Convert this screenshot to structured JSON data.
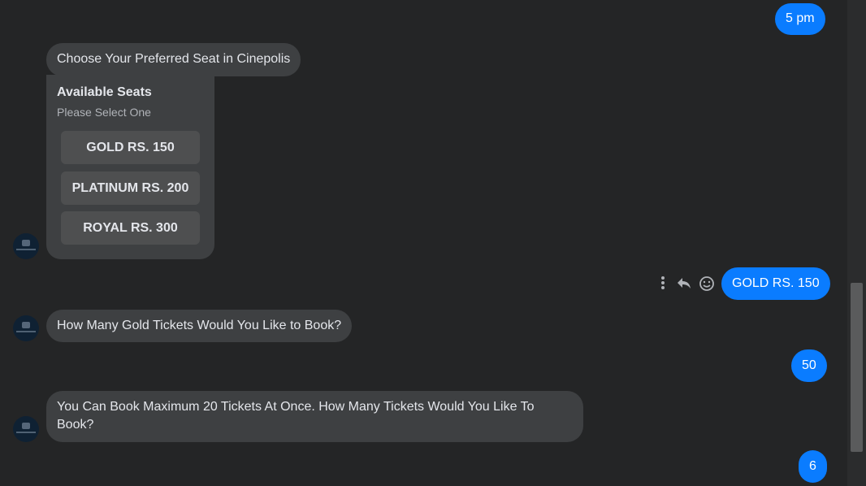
{
  "messages": {
    "out_time": "5 pm",
    "in_choose_seat": "Choose Your Preferred Seat in Cinepolis",
    "out_gold": "GOLD RS. 150",
    "in_how_many_gold": "How Many Gold Tickets Would You Like to Book?",
    "out_50": "50",
    "in_max_line1": "You Can Book Maximum 20 Tickets At Once. How Many Tickets Would You Like To",
    "in_max_line2": "Book?",
    "out_6": "6"
  },
  "seat_card": {
    "title": "Available Seats",
    "subtitle": "Please Select One",
    "options": [
      "GOLD RS. 150",
      "PLATINUM RS. 200",
      "ROYAL RS. 300"
    ]
  },
  "icons": {
    "more": "more-options-icon",
    "reply": "reply-icon",
    "react": "smiley-icon"
  },
  "colors": {
    "background": "#242526",
    "outgoing": "#0a7cff",
    "incoming": "#3e4042",
    "button": "#4e4f50"
  }
}
